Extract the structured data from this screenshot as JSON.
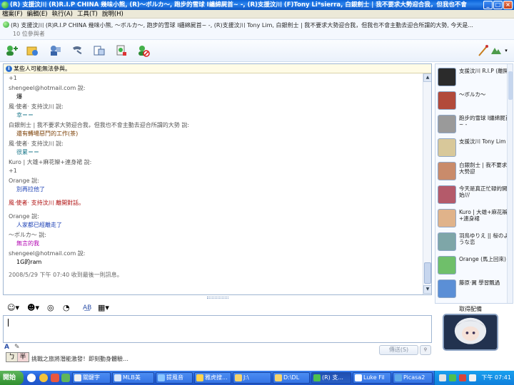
{
  "window": {
    "title": "(R) 支援汶川 (R)R.I.P CHINA 幾味小熊, (R)〜ボルカ〜, 跑步的雪球 I纏綿屍首~ -, (R)支援汶川 (F)Tony Li*sierra, 白銀劍士 | 我不要求大勢迎合我，但我也不會..."
  },
  "menu": [
    "檔案(F)",
    "編輯(E)",
    "執行(A)",
    "工具(T)",
    "說明(H)"
  ],
  "participants_header": {
    "line": "(R) 支援汶川 (R)R.I.P CHINA 幾味小熊, 〜ボルカ〜, 跑步的雪球 I纏綿屍首~ -, (R)支援汶川 Tony Lim, 白銀劍士 | 我不要求大勢迎合我，但我也不會主動去迎合所謂的大勢, 今天是...",
    "count": "10 位參與者"
  },
  "info_bar": "某些人可能無法參與。",
  "messages": [
    {
      "kind": "sender",
      "text": "+1"
    },
    {
      "kind": "sender",
      "text": "shengeel@hotmail.com 說:"
    },
    {
      "kind": "body",
      "color": "plain",
      "text": "爆"
    },
    {
      "kind": "sender",
      "text": "風‧使者‧ 支持汶川 說:"
    },
    {
      "kind": "body",
      "color": "teal",
      "text": "幸＝＝"
    },
    {
      "kind": "sender",
      "text": "白銀劍士 | 我不要求大勢迎合我，但我也不會主動去迎合所謂的大勢 說:"
    },
    {
      "kind": "body",
      "color": "brown",
      "text": "還有轉場惡鬥的工作(茶)"
    },
    {
      "kind": "sender",
      "text": "風‧使者‧ 支持汶川 說:"
    },
    {
      "kind": "body",
      "color": "teal",
      "text": "很累＝＝"
    },
    {
      "kind": "sender",
      "text": "Kuro | 大雄+麻花辮+連身裙 說:"
    },
    {
      "kind": "sender",
      "text": "+1"
    },
    {
      "kind": "sender",
      "text": "Orange 說:"
    },
    {
      "kind": "body",
      "color": "blue",
      "text": "別再拉他了"
    },
    {
      "kind": "sys",
      "text": "風‧使者‧ 支持汶川 離開對話。"
    },
    {
      "kind": "sender",
      "text": "Orange 說:"
    },
    {
      "kind": "body",
      "color": "blue",
      "text": "人家都已經離走了"
    },
    {
      "kind": "sender",
      "text": "〜ボルカ〜 說:"
    },
    {
      "kind": "body",
      "color": "purple",
      "text": "無言的我"
    },
    {
      "kind": "sender",
      "text": "shengeel@hotmail.com 說:"
    },
    {
      "kind": "body",
      "color": "plain",
      "text": "1G的ram"
    },
    {
      "kind": "ts",
      "text": "2008/5/29 下午 07:40 收到最後一則訊息。"
    }
  ],
  "participants_list": [
    {
      "name": "支援汶川 R.I.P (離開)",
      "color": "#2b2b2b"
    },
    {
      "name": "〜ボルカ〜",
      "color": "#b24a3a"
    },
    {
      "name": "跑步的雪球 I纏綿屍首~ -",
      "color": "#9a9a9a"
    },
    {
      "name": "支援汶川 Tony Lim",
      "color": "#d8c89a"
    },
    {
      "name": "白銀劍士 | 我不要求大勢迎",
      "color": "#c98b6b"
    },
    {
      "name": "今天是真正忙碌的開始///",
      "color": "#b45a6a"
    },
    {
      "name": "Kuro | 大雄+麻花辮+連身裙",
      "color": "#e0b38a"
    },
    {
      "name": "羽鳥ゆりえ || 桜のような恋",
      "color": "#7ea6a8"
    },
    {
      "name": "Orange (馬上回來)",
      "color": "#6fbf6a"
    },
    {
      "name": "藤原‧翼 學習飄過",
      "color": "#5b8fd6"
    }
  ],
  "display_picture_label": "取得配備",
  "send_label": "傳送(S)",
  "ime": {
    "k1": "ㄅ",
    "k2": "半"
  },
  "status_text": "挑戰之旅將潛能激發！即刻動身體驗…",
  "taskbar": {
    "start": "開始",
    "tasks": [
      "關鍵字",
      "MLB美",
      "提風音",
      "雅虎搜...",
      "J:\\",
      "D:\\DL",
      "(R) 支...",
      "Luke Fil",
      "Picasa2"
    ],
    "clock": "下午 07:41"
  }
}
